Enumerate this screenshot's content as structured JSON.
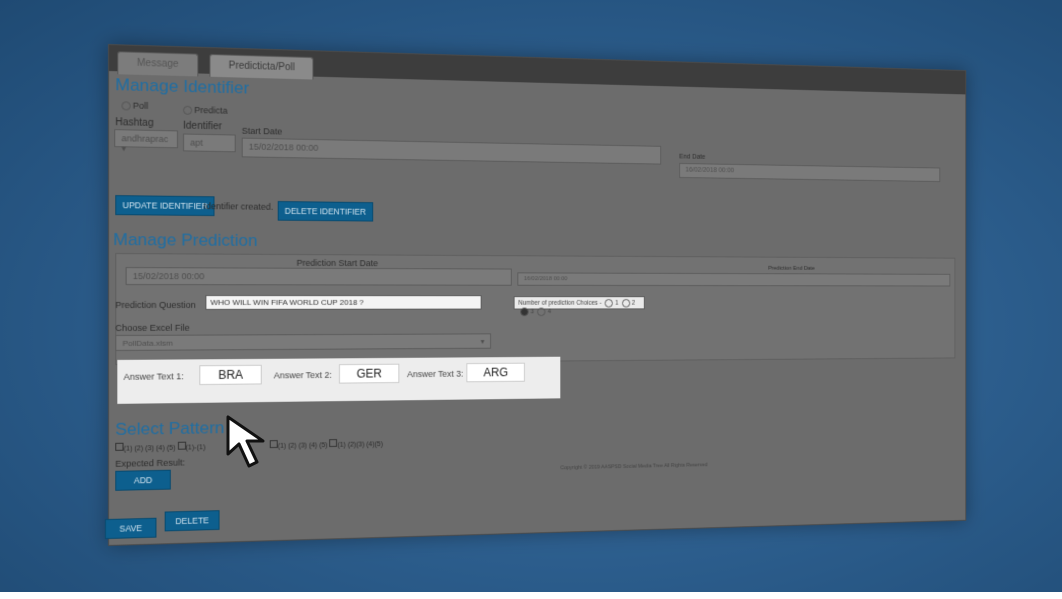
{
  "tabs": [
    {
      "label": "Message"
    },
    {
      "label": "Predicticta/Poll"
    }
  ],
  "identifier": {
    "title": "Manage Identifier",
    "radio_poll": "Poll",
    "radio_predicta": "Predicta",
    "hashtag_label": "Hashtag",
    "hashtag_value": "andhraprac",
    "identifier_label": "Identifier",
    "identifier_value": "apt",
    "start_date_label": "Start Date",
    "start_date_value": "15/02/2018 00:00",
    "end_date_label": "End Date",
    "end_date_value": "16/02/2018 00:00",
    "update_button": "UPDATE IDENTIFIER",
    "status_text": "Identifier created.",
    "delete_button": "DELETE IDENTIFIER"
  },
  "prediction": {
    "title": "Manage Prediction",
    "start_label": "Prediction Start Date",
    "start_value": "15/02/2018 00:00",
    "end_label": "Prediction End Date",
    "end_value": "16/02/2018 00:00",
    "question_label": "Prediction Question",
    "question_value": "WHO WILL WIN FIFA WORLD CUP 2018 ?",
    "choices_label": "Number of prediction Choices -",
    "choices": [
      "1",
      "2",
      "3",
      "4"
    ],
    "choices_selected": "3",
    "excel_label": "Choose Excel File",
    "excel_value": "PollData.xlsm",
    "answer1_label": "Answer Text 1:",
    "answer1_value": "BRA",
    "answer2_label": "Answer Text 2:",
    "answer2_value": "GER",
    "answer3_label": "Answer Text 3:",
    "answer3_value": "ARG"
  },
  "pattern": {
    "title": "Select Pattern",
    "options_text_1": "(1) (2) (3) (4) (5)",
    "options_text_2": "(1)-(1)",
    "options_text_3": "(1) (2) (3) (4) (5)",
    "options_text_4": "(1) (2)(3) (4)(5)",
    "expected_label": "Expected Result:",
    "add_button": "ADD"
  },
  "footer": {
    "copyright": "Copyright © 2019 AASPSD Social Media Tree All Rights Reserved",
    "save_button": "SAVE",
    "delete_button": "DELETE"
  }
}
